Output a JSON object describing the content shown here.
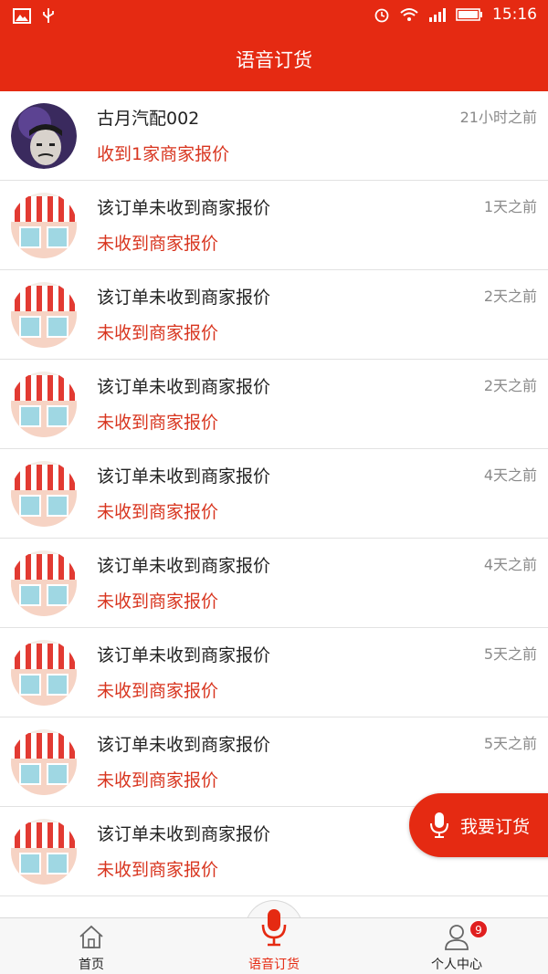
{
  "status_bar": {
    "time": "15:16"
  },
  "header": {
    "title": "语音订货"
  },
  "orders": [
    {
      "title": "古月汽配002",
      "subtitle": "收到1家商家报价",
      "time": "21小时之前",
      "avatar": "user-photo"
    },
    {
      "title": "该订单未收到商家报价",
      "subtitle": "未收到商家报价",
      "time": "1天之前",
      "avatar": "shop-icon"
    },
    {
      "title": "该订单未收到商家报价",
      "subtitle": "未收到商家报价",
      "time": "2天之前",
      "avatar": "shop-icon"
    },
    {
      "title": "该订单未收到商家报价",
      "subtitle": "未收到商家报价",
      "time": "2天之前",
      "avatar": "shop-icon"
    },
    {
      "title": "该订单未收到商家报价",
      "subtitle": "未收到商家报价",
      "time": "4天之前",
      "avatar": "shop-icon"
    },
    {
      "title": "该订单未收到商家报价",
      "subtitle": "未收到商家报价",
      "time": "4天之前",
      "avatar": "shop-icon"
    },
    {
      "title": "该订单未收到商家报价",
      "subtitle": "未收到商家报价",
      "time": "5天之前",
      "avatar": "shop-icon"
    },
    {
      "title": "该订单未收到商家报价",
      "subtitle": "未收到商家报价",
      "time": "5天之前",
      "avatar": "shop-icon"
    },
    {
      "title": "该订单未收到商家报价",
      "subtitle": "未收到商家报价",
      "time": "",
      "avatar": "shop-icon"
    }
  ],
  "fab": {
    "label": "我要订货",
    "icon": "microphone-icon"
  },
  "bottom_nav": {
    "home": {
      "label": "首页",
      "icon": "home-icon"
    },
    "voice": {
      "label": "语音订货",
      "icon": "microphone-icon"
    },
    "me": {
      "label": "个人中心",
      "icon": "user-icon",
      "badge": "9"
    }
  },
  "colors": {
    "brand": "#e52a12",
    "subtitle": "#d8351f",
    "time": "#8a8a8a"
  }
}
